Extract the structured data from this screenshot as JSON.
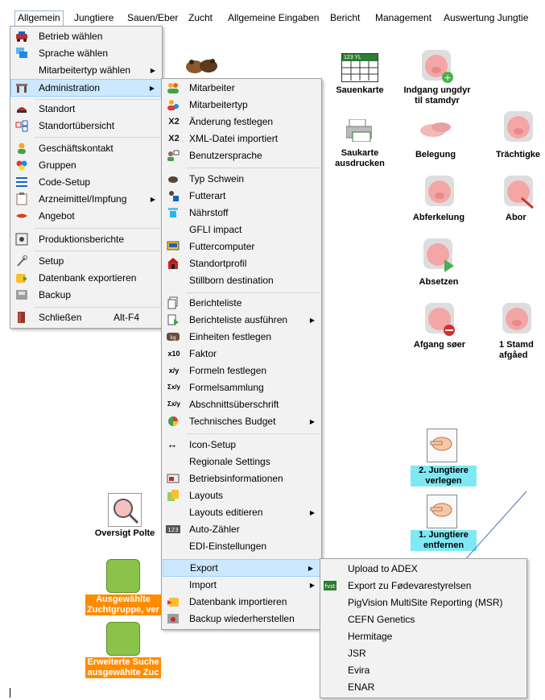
{
  "menubar": {
    "items": [
      "Allgemein",
      "Jungtiere",
      "Sauen/Eber",
      "Zucht",
      "Allgemeine Eingaben",
      "Bericht",
      "Management",
      "Auswertung Jungtie"
    ]
  },
  "menu_allgemein": {
    "items": [
      {
        "label": "Betrieb wählen"
      },
      {
        "label": "Sprache wählen"
      },
      {
        "label": "Mitarbeitertyp wählen"
      },
      {
        "label": "Administration"
      },
      {
        "label": "Standort"
      },
      {
        "label": "Standortübersicht"
      },
      {
        "label": "Geschäftskontakt"
      },
      {
        "label": "Gruppen"
      },
      {
        "label": "Code-Setup"
      },
      {
        "label": "Arzneimittel/Impfung"
      },
      {
        "label": "Angebot"
      },
      {
        "label": "Produktionsberichte"
      },
      {
        "label": "Setup"
      },
      {
        "label": "Datenbank exportieren"
      },
      {
        "label": "Backup"
      },
      {
        "label": "Schließen",
        "shortcut": "Alt-F4"
      }
    ]
  },
  "menu_admin": {
    "items": [
      {
        "label": "Mitarbeiter"
      },
      {
        "label": "Mitarbeitertyp"
      },
      {
        "label": "Änderung festlegen",
        "icon": "X2"
      },
      {
        "label": "XML-Datei importiert",
        "icon": "X2"
      },
      {
        "label": "Benutzersprache"
      },
      {
        "label": "Typ Schwein"
      },
      {
        "label": "Futterart"
      },
      {
        "label": "Nährstoff"
      },
      {
        "label": "GFLI impact"
      },
      {
        "label": "Futtercomputer"
      },
      {
        "label": "Standortprofil"
      },
      {
        "label": "Stillborn destination"
      },
      {
        "label": "Berichteliste"
      },
      {
        "label": "Berichteliste ausführen"
      },
      {
        "label": "Einheiten festlegen"
      },
      {
        "label": "Faktor",
        "icon": "x10"
      },
      {
        "label": "Formeln festlegen",
        "icon": "x/y"
      },
      {
        "label": "Formelsammlung",
        "icon": "Σx/y"
      },
      {
        "label": "Abschnittsüberschrift",
        "icon": "Σx/y"
      },
      {
        "label": "Technisches Budget"
      },
      {
        "label": "Icon-Setup"
      },
      {
        "label": "Regionale Settings"
      },
      {
        "label": "Betriebsinformationen"
      },
      {
        "label": "Layouts"
      },
      {
        "label": "Layouts editieren"
      },
      {
        "label": "Auto-Zähler"
      },
      {
        "label": "EDI-Einstellungen"
      },
      {
        "label": "Export"
      },
      {
        "label": "Import"
      },
      {
        "label": "Datenbank importieren"
      },
      {
        "label": "Backup wiederherstellen"
      }
    ]
  },
  "menu_export": {
    "items": [
      {
        "label": "Upload to ADEX"
      },
      {
        "label": "Export zu Fødevarestyrelsen"
      },
      {
        "label": "PigVision MultiSite Reporting (MSR)"
      },
      {
        "label": "CEFN Genetics"
      },
      {
        "label": "Hermitage"
      },
      {
        "label": "JSR"
      },
      {
        "label": "Evira"
      },
      {
        "label": "ENAR"
      }
    ]
  },
  "desktop": {
    "sauenkarte": "Sauenkarte",
    "sauenkarte_cal": "123 YL",
    "indgang": "Indgang ungdyr til stamdyr",
    "saukarte": "Saukarte ausdrucken",
    "belegung": "Belegung",
    "traechtig": "Trächtigke",
    "abferkelung": "Abferkelung",
    "abor": "Abor",
    "absetzen": "Absetzen",
    "afgang": "Afgang søer",
    "stamd": "1 Stamd afgåed",
    "jungtiere_verlegen": "2. Jungtiere verlegen",
    "jungtiere_entfernen": "1. Jungtiere entfernen",
    "oversigt": "Oversigt Polte",
    "zuchtgruppe": "Ausgewählte Zuchtgruppe, ver",
    "erweiterte": "Erweiterte Suche ausgewählte Zuc"
  },
  "colors": {
    "highlight": "#cce8ff",
    "cyan_label": "#7fe9f3",
    "orange_label": "#ff8c00",
    "green_tile": "#8bc34a"
  }
}
